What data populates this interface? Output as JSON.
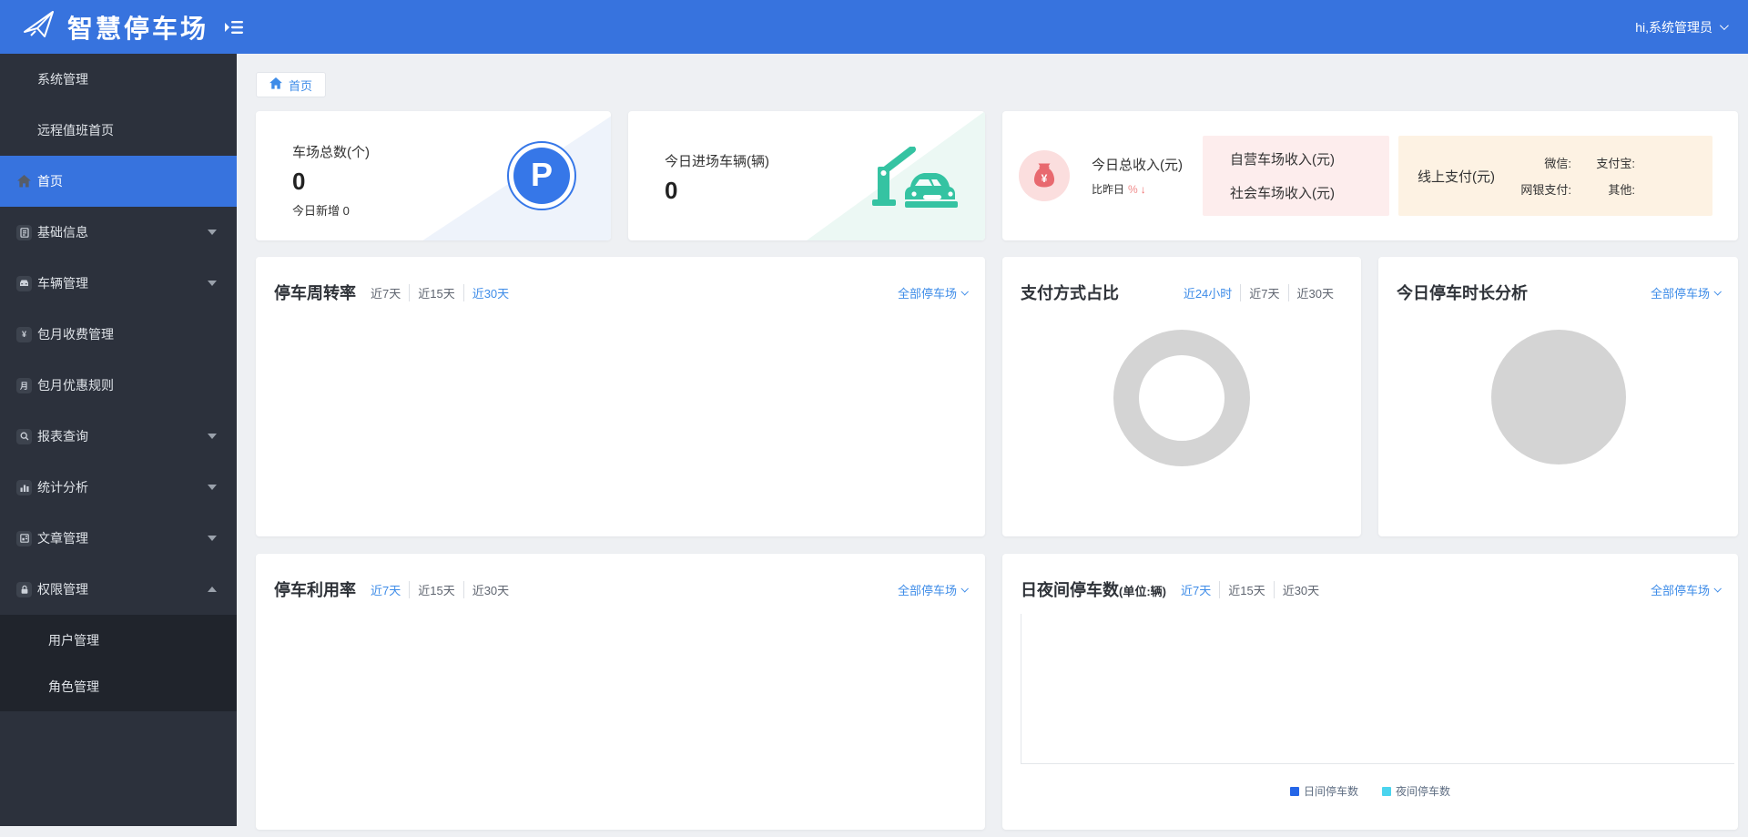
{
  "header": {
    "app_title": "智慧停车场",
    "user": "hi,系统管理员"
  },
  "breadcrumb": {
    "home": "首页"
  },
  "sidebar": {
    "items": [
      {
        "label": "系统管理"
      },
      {
        "label": "远程值班首页"
      },
      {
        "label": "首页",
        "active": true
      },
      {
        "label": "基础信息"
      },
      {
        "label": "车辆管理"
      },
      {
        "label": "包月收费管理"
      },
      {
        "label": "包月优惠规则"
      },
      {
        "label": "报表查询"
      },
      {
        "label": "统计分析"
      },
      {
        "label": "文章管理"
      },
      {
        "label": "权限管理",
        "expanded": true,
        "children": [
          {
            "label": "用户管理"
          },
          {
            "label": "角色管理"
          }
        ]
      }
    ]
  },
  "stats": {
    "parks": {
      "title": "车场总数(个)",
      "value": "0",
      "sub_label": "今日新增",
      "sub_value": "0"
    },
    "entries": {
      "title": "今日进场车辆(辆)",
      "value": "0"
    },
    "revenue": {
      "title": "今日总收入(元)",
      "compare": "比昨日",
      "percent": "%",
      "arrow": "↓",
      "own_label": "自营车场收入(元)",
      "social_label": "社会车场收入(元)",
      "online_label": "线上支付(元)",
      "wechat": "微信:",
      "alipay": "支付宝:",
      "netbank": "网银支付:",
      "other": "其他:"
    }
  },
  "cards": {
    "turnover": {
      "title": "停车周转率",
      "filters": [
        "近7天",
        "近15天",
        "近30天"
      ],
      "active": "近30天",
      "selector": "全部停车场"
    },
    "payment": {
      "title": "支付方式占比",
      "filters": [
        "近24小时",
        "近7天",
        "近30天"
      ],
      "active": "近24小时"
    },
    "duration": {
      "title": "今日停车时长分析",
      "selector": "全部停车场"
    },
    "utilization": {
      "title": "停车利用率",
      "filters": [
        "近7天",
        "近15天",
        "近30天"
      ],
      "active": "近7天",
      "selector": "全部停车场"
    },
    "daynight": {
      "title": "日夜间停车数",
      "unit": "(单位:辆)",
      "filters": [
        "近7天",
        "近15天",
        "近30天"
      ],
      "active": "近7天",
      "selector": "全部停车场",
      "legend": [
        {
          "label": "日间停车数",
          "color": "#2566e8"
        },
        {
          "label": "夜间停车数",
          "color": "#4bd4ee"
        }
      ]
    }
  },
  "colors": {
    "header_blue": "#3773de",
    "accent_blue": "#3e8ce8",
    "sidebar_bg": "#2c313c",
    "teal": "#35c3a2",
    "placeholder_gray": "#d4d4d4",
    "pink_icon": "#e8696f",
    "down_red": "#ef6b6b",
    "legend_day": "#2566e8",
    "legend_night": "#4bd4ee"
  }
}
